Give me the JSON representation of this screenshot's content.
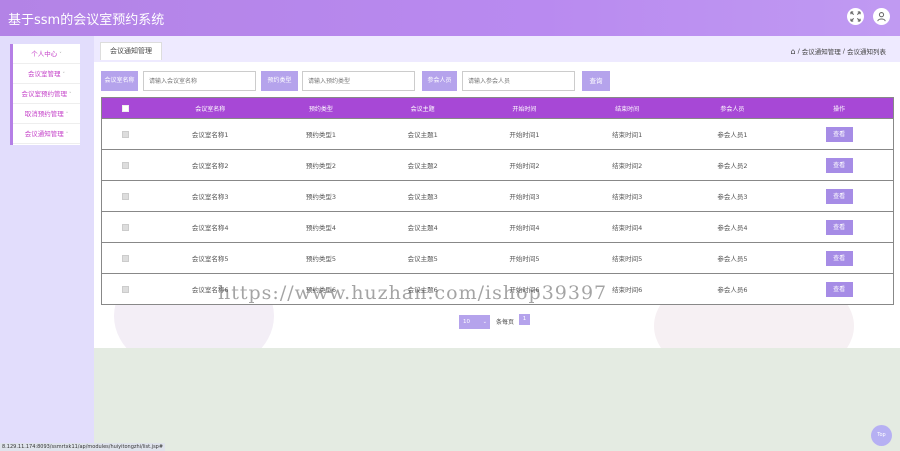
{
  "app": {
    "title": "基于ssm的会议室预约系统"
  },
  "header_icons": [
    {
      "name": "fullscreen-icon"
    },
    {
      "name": "user-icon"
    }
  ],
  "sidebar": {
    "items": [
      {
        "label": "个人中心",
        "caret": "˅"
      },
      {
        "label": "会议室管理",
        "caret": "˅"
      },
      {
        "label": "会议室预约管理",
        "caret": "˅"
      },
      {
        "label": "取消预约管理",
        "caret": "˅"
      },
      {
        "label": "会议通知管理",
        "caret": "˅"
      }
    ]
  },
  "page_tab": {
    "label": "会议通知管理"
  },
  "breadcrumb": {
    "home_icon": "⌂",
    "sep1": "/",
    "item1": "会议通知管理",
    "sep2": "/",
    "item2": "会议通知列表"
  },
  "search": {
    "room_label": "会议室名称",
    "room_placeholder": "请输入会议室名称",
    "type_label": "预约类型",
    "type_placeholder": "请输入预约类型",
    "attendee_label": "参会人员",
    "attendee_placeholder": "请输入参会人员",
    "search_button": "查询"
  },
  "table": {
    "headers": [
      "会议室名称",
      "预约类型",
      "会议主题",
      "开始时间",
      "结束时间",
      "参会人员",
      "操作"
    ],
    "rows": [
      {
        "room": "会议室名称1",
        "type": "预约类型1",
        "topic": "会议主题1",
        "start": "开始时间1",
        "end": "结束时间1",
        "attendee": "参会人员1",
        "action": "查看"
      },
      {
        "room": "会议室名称2",
        "type": "预约类型2",
        "topic": "会议主题2",
        "start": "开始时间2",
        "end": "结束时间2",
        "attendee": "参会人员2",
        "action": "查看"
      },
      {
        "room": "会议室名称3",
        "type": "预约类型3",
        "topic": "会议主题3",
        "start": "开始时间3",
        "end": "结束时间3",
        "attendee": "参会人员3",
        "action": "查看"
      },
      {
        "room": "会议室名称4",
        "type": "预约类型4",
        "topic": "会议主题4",
        "start": "开始时间4",
        "end": "结束时间4",
        "attendee": "参会人员4",
        "action": "查看"
      },
      {
        "room": "会议室名称5",
        "type": "预约类型5",
        "topic": "会议主题5",
        "start": "开始时间5",
        "end": "结束时间5",
        "attendee": "参会人员5",
        "action": "查看"
      },
      {
        "room": "会议室名称6",
        "type": "预约类型6",
        "topic": "会议主题6",
        "start": "开始时间6",
        "end": "结束时间6",
        "attendee": "参会人员6",
        "action": "查看"
      }
    ]
  },
  "pagination": {
    "page_size": "10",
    "page_size_caret": "⌄",
    "per_page_label": "条每页",
    "current_page": "1"
  },
  "watermark": "https://www.huzhan.com/ishop39397",
  "status": {
    "url": "8.129.11.174:8093/ssmrtxk11/ap/modules/huiyitongzhi/list.jsp#"
  },
  "back_to_top": {
    "label": "Top"
  },
  "colors": {
    "header": "#b98af0",
    "table_header": "#a748d6",
    "button": "#a68ce6",
    "sidebar_text": "#c543c9"
  }
}
